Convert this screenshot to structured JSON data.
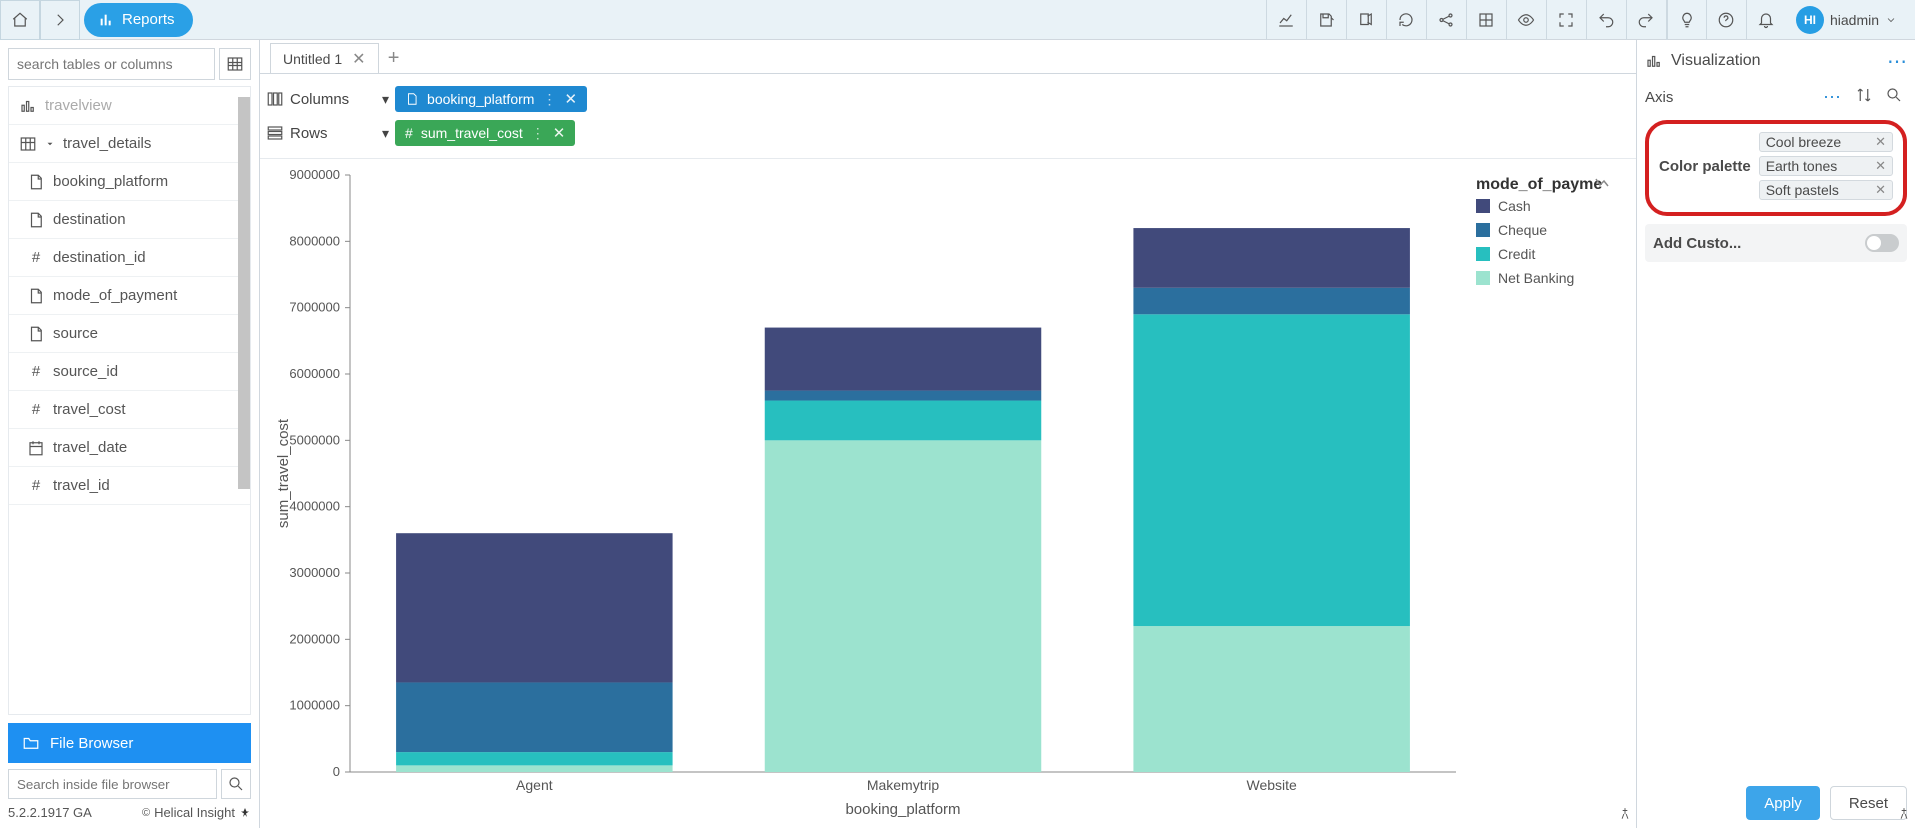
{
  "nav": {
    "reports": "Reports"
  },
  "toolbar_icons": [
    "chart-line",
    "save",
    "export",
    "refresh",
    "share",
    "layout",
    "eye",
    "fullscreen",
    "undo",
    "redo",
    "bulb",
    "help",
    "bell"
  ],
  "user": {
    "initials": "HI",
    "name": "hiadmin"
  },
  "sidebar": {
    "search_placeholder": "search tables or columns",
    "items": [
      "travelview",
      "travel_details",
      "booking_platform",
      "destination",
      "destination_id",
      "mode_of_payment",
      "source",
      "source_id",
      "travel_cost",
      "travel_date",
      "travel_id"
    ],
    "file_browser_label": "File Browser",
    "file_search_placeholder": "Search inside file browser",
    "version": "5.2.2.1917 GA",
    "powered_by": "Helical Insight"
  },
  "canvas": {
    "tab_title": "Untitled 1",
    "columns_label": "Columns",
    "rows_label": "Rows",
    "column_pill": "booking_platform",
    "row_pill": "sum_travel_cost"
  },
  "chart_data": {
    "type": "bar",
    "stacked": true,
    "xlabel": "booking_platform",
    "ylabel": "sum_travel_cost",
    "legend_title": "mode_of_payme",
    "categories": [
      "Agent",
      "Makemytrip",
      "Website"
    ],
    "series": [
      {
        "name": "Cash",
        "color": "#414a7b",
        "values": [
          2250000,
          950000,
          900000
        ]
      },
      {
        "name": "Cheque",
        "color": "#2b6f9e",
        "values": [
          1050000,
          150000,
          400000
        ]
      },
      {
        "name": "Credit",
        "color": "#27bfbf",
        "values": [
          200000,
          600000,
          4700000
        ]
      },
      {
        "name": "Net Banking",
        "color": "#9ce3cf",
        "values": [
          100000,
          5000000,
          2200000
        ]
      }
    ],
    "ylim": [
      0,
      9000000
    ],
    "yticks": [
      0,
      1000000,
      2000000,
      3000000,
      4000000,
      5000000,
      6000000,
      7000000,
      8000000,
      9000000
    ]
  },
  "rpanel": {
    "viz_label": "Visualization",
    "axis_label": "Axis",
    "color_palette_label": "Color palette",
    "palettes": [
      "Cool breeze",
      "Earth tones",
      "Soft pastels"
    ],
    "add_custom_label": "Add Custo...",
    "apply_label": "Apply",
    "reset_label": "Reset"
  }
}
